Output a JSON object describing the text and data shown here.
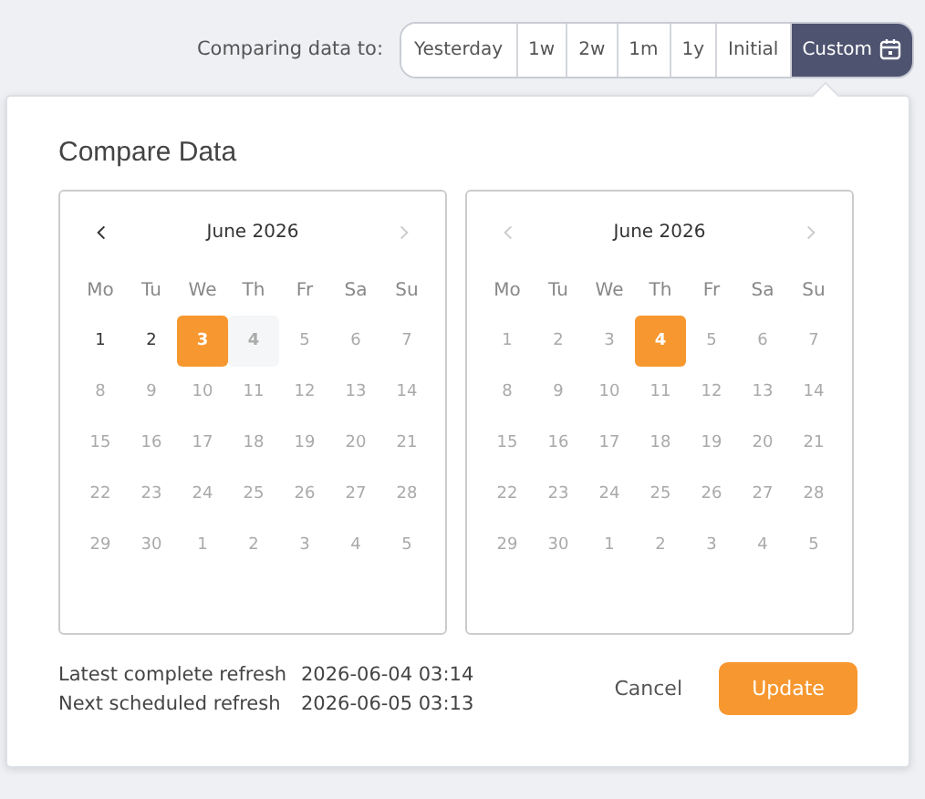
{
  "compare_bar": {
    "label": "Comparing data to:",
    "options": [
      {
        "label": "Yesterday",
        "selected": false,
        "icon": false
      },
      {
        "label": "1w",
        "selected": false,
        "icon": false
      },
      {
        "label": "2w",
        "selected": false,
        "icon": false
      },
      {
        "label": "1m",
        "selected": false,
        "icon": false
      },
      {
        "label": "1y",
        "selected": false,
        "icon": false
      },
      {
        "label": "Initial",
        "selected": false,
        "icon": false
      },
      {
        "label": "Custom",
        "selected": true,
        "icon": true
      }
    ]
  },
  "dialog": {
    "title": "Compare Data",
    "calendars": [
      {
        "month": "June 2026",
        "prev_disabled": false,
        "next_disabled": true,
        "weekdays": [
          "Mo",
          "Tu",
          "We",
          "Th",
          "Fr",
          "Sa",
          "Su"
        ],
        "days": [
          {
            "label": "1",
            "disabled": false,
            "selected": false,
            "highlighted": false
          },
          {
            "label": "2",
            "disabled": false,
            "selected": false,
            "highlighted": false
          },
          {
            "label": "3",
            "disabled": false,
            "selected": true,
            "highlighted": false
          },
          {
            "label": "4",
            "disabled": true,
            "selected": false,
            "highlighted": true
          },
          {
            "label": "5",
            "disabled": true,
            "selected": false,
            "highlighted": false
          },
          {
            "label": "6",
            "disabled": true,
            "selected": false,
            "highlighted": false
          },
          {
            "label": "7",
            "disabled": true,
            "selected": false,
            "highlighted": false
          },
          {
            "label": "8",
            "disabled": true,
            "selected": false,
            "highlighted": false
          },
          {
            "label": "9",
            "disabled": true,
            "selected": false,
            "highlighted": false
          },
          {
            "label": "10",
            "disabled": true,
            "selected": false,
            "highlighted": false
          },
          {
            "label": "11",
            "disabled": true,
            "selected": false,
            "highlighted": false
          },
          {
            "label": "12",
            "disabled": true,
            "selected": false,
            "highlighted": false
          },
          {
            "label": "13",
            "disabled": true,
            "selected": false,
            "highlighted": false
          },
          {
            "label": "14",
            "disabled": true,
            "selected": false,
            "highlighted": false
          },
          {
            "label": "15",
            "disabled": true,
            "selected": false,
            "highlighted": false
          },
          {
            "label": "16",
            "disabled": true,
            "selected": false,
            "highlighted": false
          },
          {
            "label": "17",
            "disabled": true,
            "selected": false,
            "highlighted": false
          },
          {
            "label": "18",
            "disabled": true,
            "selected": false,
            "highlighted": false
          },
          {
            "label": "19",
            "disabled": true,
            "selected": false,
            "highlighted": false
          },
          {
            "label": "20",
            "disabled": true,
            "selected": false,
            "highlighted": false
          },
          {
            "label": "21",
            "disabled": true,
            "selected": false,
            "highlighted": false
          },
          {
            "label": "22",
            "disabled": true,
            "selected": false,
            "highlighted": false
          },
          {
            "label": "23",
            "disabled": true,
            "selected": false,
            "highlighted": false
          },
          {
            "label": "24",
            "disabled": true,
            "selected": false,
            "highlighted": false
          },
          {
            "label": "25",
            "disabled": true,
            "selected": false,
            "highlighted": false
          },
          {
            "label": "26",
            "disabled": true,
            "selected": false,
            "highlighted": false
          },
          {
            "label": "27",
            "disabled": true,
            "selected": false,
            "highlighted": false
          },
          {
            "label": "28",
            "disabled": true,
            "selected": false,
            "highlighted": false
          },
          {
            "label": "29",
            "disabled": true,
            "selected": false,
            "highlighted": false
          },
          {
            "label": "30",
            "disabled": true,
            "selected": false,
            "highlighted": false
          },
          {
            "label": "1",
            "disabled": true,
            "selected": false,
            "highlighted": false
          },
          {
            "label": "2",
            "disabled": true,
            "selected": false,
            "highlighted": false
          },
          {
            "label": "3",
            "disabled": true,
            "selected": false,
            "highlighted": false
          },
          {
            "label": "4",
            "disabled": true,
            "selected": false,
            "highlighted": false
          },
          {
            "label": "5",
            "disabled": true,
            "selected": false,
            "highlighted": false
          }
        ]
      },
      {
        "month": "June 2026",
        "prev_disabled": true,
        "next_disabled": true,
        "weekdays": [
          "Mo",
          "Tu",
          "We",
          "Th",
          "Fr",
          "Sa",
          "Su"
        ],
        "days": [
          {
            "label": "1",
            "disabled": true,
            "selected": false,
            "highlighted": false
          },
          {
            "label": "2",
            "disabled": true,
            "selected": false,
            "highlighted": false
          },
          {
            "label": "3",
            "disabled": true,
            "selected": false,
            "highlighted": false
          },
          {
            "label": "4",
            "disabled": false,
            "selected": true,
            "highlighted": false
          },
          {
            "label": "5",
            "disabled": true,
            "selected": false,
            "highlighted": false
          },
          {
            "label": "6",
            "disabled": true,
            "selected": false,
            "highlighted": false
          },
          {
            "label": "7",
            "disabled": true,
            "selected": false,
            "highlighted": false
          },
          {
            "label": "8",
            "disabled": true,
            "selected": false,
            "highlighted": false
          },
          {
            "label": "9",
            "disabled": true,
            "selected": false,
            "highlighted": false
          },
          {
            "label": "10",
            "disabled": true,
            "selected": false,
            "highlighted": false
          },
          {
            "label": "11",
            "disabled": true,
            "selected": false,
            "highlighted": false
          },
          {
            "label": "12",
            "disabled": true,
            "selected": false,
            "highlighted": false
          },
          {
            "label": "13",
            "disabled": true,
            "selected": false,
            "highlighted": false
          },
          {
            "label": "14",
            "disabled": true,
            "selected": false,
            "highlighted": false
          },
          {
            "label": "15",
            "disabled": true,
            "selected": false,
            "highlighted": false
          },
          {
            "label": "16",
            "disabled": true,
            "selected": false,
            "highlighted": false
          },
          {
            "label": "17",
            "disabled": true,
            "selected": false,
            "highlighted": false
          },
          {
            "label": "18",
            "disabled": true,
            "selected": false,
            "highlighted": false
          },
          {
            "label": "19",
            "disabled": true,
            "selected": false,
            "highlighted": false
          },
          {
            "label": "20",
            "disabled": true,
            "selected": false,
            "highlighted": false
          },
          {
            "label": "21",
            "disabled": true,
            "selected": false,
            "highlighted": false
          },
          {
            "label": "22",
            "disabled": true,
            "selected": false,
            "highlighted": false
          },
          {
            "label": "23",
            "disabled": true,
            "selected": false,
            "highlighted": false
          },
          {
            "label": "24",
            "disabled": true,
            "selected": false,
            "highlighted": false
          },
          {
            "label": "25",
            "disabled": true,
            "selected": false,
            "highlighted": false
          },
          {
            "label": "26",
            "disabled": true,
            "selected": false,
            "highlighted": false
          },
          {
            "label": "27",
            "disabled": true,
            "selected": false,
            "highlighted": false
          },
          {
            "label": "28",
            "disabled": true,
            "selected": false,
            "highlighted": false
          },
          {
            "label": "29",
            "disabled": true,
            "selected": false,
            "highlighted": false
          },
          {
            "label": "30",
            "disabled": true,
            "selected": false,
            "highlighted": false
          },
          {
            "label": "1",
            "disabled": true,
            "selected": false,
            "highlighted": false
          },
          {
            "label": "2",
            "disabled": true,
            "selected": false,
            "highlighted": false
          },
          {
            "label": "3",
            "disabled": true,
            "selected": false,
            "highlighted": false
          },
          {
            "label": "4",
            "disabled": true,
            "selected": false,
            "highlighted": false
          },
          {
            "label": "5",
            "disabled": true,
            "selected": false,
            "highlighted": false
          }
        ]
      }
    ],
    "refresh_info": [
      {
        "label": "Latest complete refresh",
        "value": "2026-06-04 03:14"
      },
      {
        "label": "Next scheduled refresh",
        "value": "2026-06-05 03:13"
      }
    ],
    "buttons": [
      {
        "label": "Cancel",
        "kind": "secondary"
      },
      {
        "label": "Update",
        "kind": "primary"
      }
    ]
  }
}
